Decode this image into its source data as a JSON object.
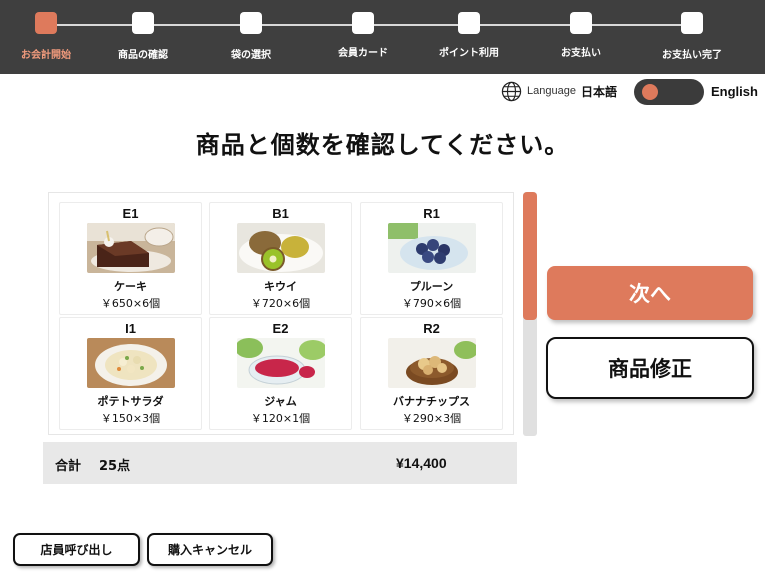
{
  "steps": [
    {
      "label": "お会計開始",
      "active": true
    },
    {
      "label": "商品の確認",
      "active": false
    },
    {
      "label": "袋の選択",
      "active": false
    },
    {
      "label": "会員カード",
      "active": false
    },
    {
      "label": "ポイント利用",
      "active": false
    },
    {
      "label": "お支払い",
      "active": false
    },
    {
      "label": "お支払い完了",
      "active": false
    }
  ],
  "language": {
    "icon": "globe-icon",
    "word": "Language",
    "current": "日本語",
    "toggle_label": "English"
  },
  "heading": "商品と個数を確認してください。",
  "products": [
    {
      "code": "E1",
      "name": "ケーキ",
      "price": "￥650×6個",
      "image": "cake-image"
    },
    {
      "code": "B1",
      "name": "キウイ",
      "price": "￥720×6個",
      "image": "kiwi-image"
    },
    {
      "code": "R1",
      "name": "プルーン",
      "price": "￥790×6個",
      "image": "prune-image"
    },
    {
      "code": "I1",
      "name": "ポテトサラダ",
      "price": "￥150×3個",
      "image": "potato-salad-image"
    },
    {
      "code": "E2",
      "name": "ジャム",
      "price": "￥120×1個",
      "image": "jam-image"
    },
    {
      "code": "R2",
      "name": "バナナチップス",
      "price": "￥290×3個",
      "image": "banana-chips-image"
    }
  ],
  "total": {
    "label": "合計",
    "count": "25点",
    "amount": "¥14,400"
  },
  "buttons": {
    "next": "次へ",
    "edit": "商品修正",
    "call_staff": "店員呼び出し",
    "cancel": "購入キャンセル"
  },
  "colors": {
    "accent": "#de7a5c",
    "header": "#3f3f3f"
  }
}
